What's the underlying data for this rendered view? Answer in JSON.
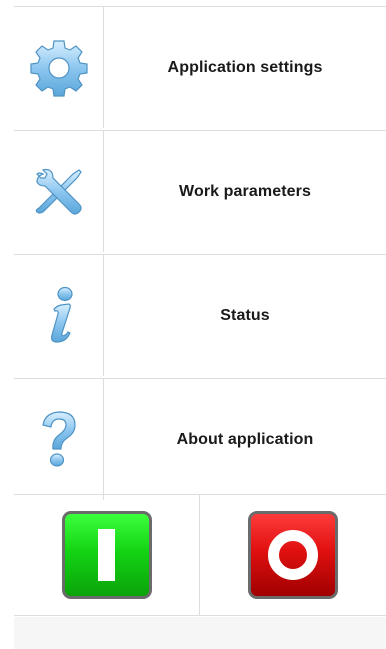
{
  "menu": {
    "items": [
      {
        "label": "Application settings",
        "icon": "gear-icon"
      },
      {
        "label": "Work parameters",
        "icon": "tools-icon"
      },
      {
        "label": "Status",
        "icon": "info-icon"
      },
      {
        "label": "About application",
        "icon": "question-icon"
      }
    ]
  },
  "controls": {
    "start_button": {
      "icon": "power-on-icon",
      "color": "#14d414"
    },
    "stop_button": {
      "icon": "power-off-icon",
      "color": "#e01010"
    }
  },
  "colors": {
    "icon_blue": "#8cc6ef",
    "divider": "#dedede",
    "footer_bg": "#f6f6f6"
  }
}
